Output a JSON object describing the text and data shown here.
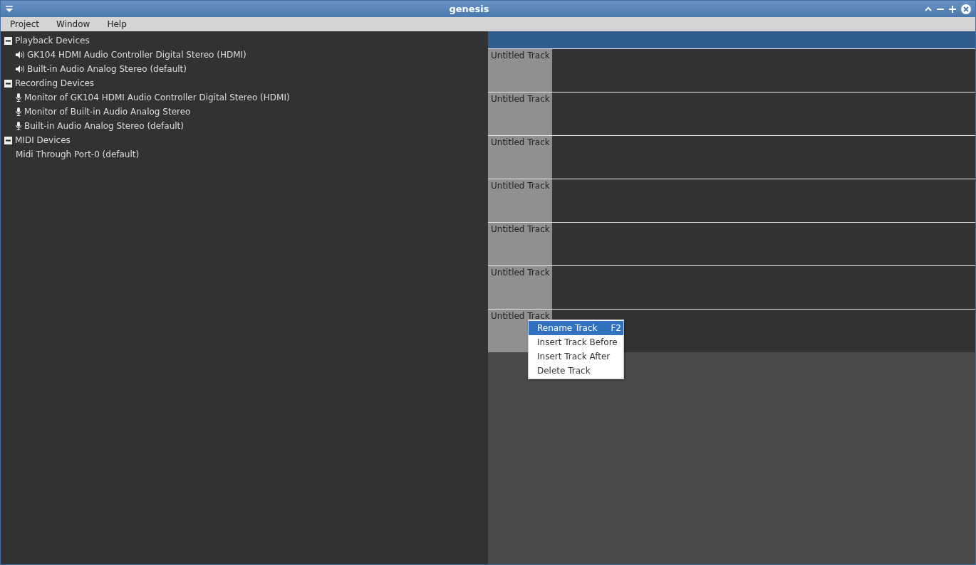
{
  "window": {
    "title": "genesis"
  },
  "menu_bar": [
    {
      "label": "Project"
    },
    {
      "label": "Window"
    },
    {
      "label": "Help"
    }
  ],
  "device_tree": [
    {
      "label": "Playback Devices",
      "expanded": true,
      "children": [
        {
          "label": "GK104 HDMI Audio Controller Digital Stereo (HDMI)",
          "kind": "speaker"
        },
        {
          "label": "Built-in Audio Analog Stereo (default)",
          "kind": "speaker"
        }
      ]
    },
    {
      "label": "Recording Devices",
      "expanded": true,
      "children": [
        {
          "label": "Monitor of GK104 HDMI Audio Controller Digital Stereo (HDMI)",
          "kind": "microphone"
        },
        {
          "label": "Monitor of Built-in Audio Analog Stereo",
          "kind": "microphone"
        },
        {
          "label": "Built-in Audio Analog Stereo (default)",
          "kind": "microphone"
        }
      ]
    },
    {
      "label": "MIDI Devices",
      "expanded": true,
      "children": [
        {
          "label": "Midi Through Port-0 (default)",
          "kind": "midi"
        }
      ]
    }
  ],
  "tracks": [
    {
      "name": "Untitled Track"
    },
    {
      "name": "Untitled Track"
    },
    {
      "name": "Untitled Track"
    },
    {
      "name": "Untitled Track"
    },
    {
      "name": "Untitled Track"
    },
    {
      "name": "Untitled Track"
    },
    {
      "name": "Untitled Track"
    }
  ],
  "context_menu": [
    {
      "label": "Rename Track",
      "shortcut": "F2",
      "selected": true
    },
    {
      "label": "Insert Track Before",
      "selected": false
    },
    {
      "label": "Insert Track After",
      "selected": false
    },
    {
      "label": "Delete Track",
      "selected": false
    }
  ]
}
